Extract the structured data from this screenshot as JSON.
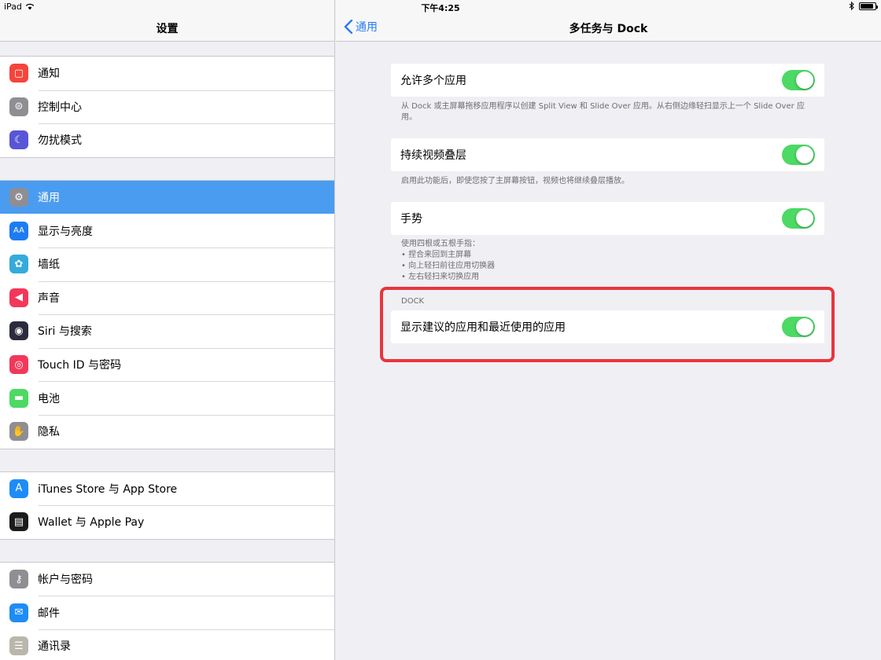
{
  "status_bar": {
    "device": "iPad",
    "time": "下午4:25",
    "battery_level": 0.9
  },
  "sidebar": {
    "title": "设置",
    "groups": [
      [
        {
          "label": "通知",
          "icon": "notifications-icon",
          "color": "#f4453c"
        },
        {
          "label": "控制中心",
          "icon": "control-center-icon",
          "color": "#8e8e93"
        },
        {
          "label": "勿扰模式",
          "icon": "moon-icon",
          "color": "#5856d6"
        }
      ],
      [
        {
          "label": "通用",
          "icon": "gear-icon",
          "color": "#8e8e93",
          "selected": true
        },
        {
          "label": "显示与亮度",
          "icon": "display-icon",
          "color": "#1e7cf2"
        },
        {
          "label": "墙纸",
          "icon": "wallpaper-icon",
          "color": "#35aadc"
        },
        {
          "label": "声音",
          "icon": "sound-icon",
          "color": "#f2385a"
        },
        {
          "label": "Siri 与搜索",
          "icon": "siri-icon",
          "color": "#2b2b3d"
        },
        {
          "label": "Touch ID 与密码",
          "icon": "fingerprint-icon",
          "color": "#f2385a"
        },
        {
          "label": "电池",
          "icon": "battery-icon",
          "color": "#4cd964"
        },
        {
          "label": "隐私",
          "icon": "hand-icon",
          "color": "#8e8e93"
        }
      ],
      [
        {
          "label": "iTunes Store 与 App Store",
          "icon": "app-store-icon",
          "color": "#1e8cf7"
        },
        {
          "label": "Wallet 与 Apple Pay",
          "icon": "wallet-icon",
          "color": "#1c1c1c"
        }
      ],
      [
        {
          "label": "帐户与密码",
          "icon": "key-icon",
          "color": "#8e8e93"
        },
        {
          "label": "邮件",
          "icon": "mail-icon",
          "color": "#1e8cf7"
        },
        {
          "label": "通讯录",
          "icon": "contacts-icon",
          "color": "#b9b6ab"
        }
      ]
    ]
  },
  "main": {
    "back_label": "通用",
    "title": "多任务与 Dock",
    "settings": [
      {
        "label": "允许多个应用",
        "on": true,
        "footnote": "从 Dock 或主屏幕拖移应用程序以创建 Split View 和 Slide Over 应用。从右侧边缘轻扫显示上一个 Slide Over 应用。"
      },
      {
        "label": "持续视频叠层",
        "on": true,
        "footnote": "启用此功能后，即使您按了主屏幕按钮，视频也将继续叠层播放。"
      },
      {
        "label": "手势",
        "on": true,
        "footnote_lines": [
          "使用四根或五根手指：",
          "• 捏合来回到主屏幕",
          "• 向上轻扫前往应用切换器",
          "• 左右轻扫来切换应用"
        ]
      }
    ],
    "dock_section": {
      "header": "DOCK",
      "label": "显示建议的应用和最近使用的应用",
      "on": true
    }
  }
}
